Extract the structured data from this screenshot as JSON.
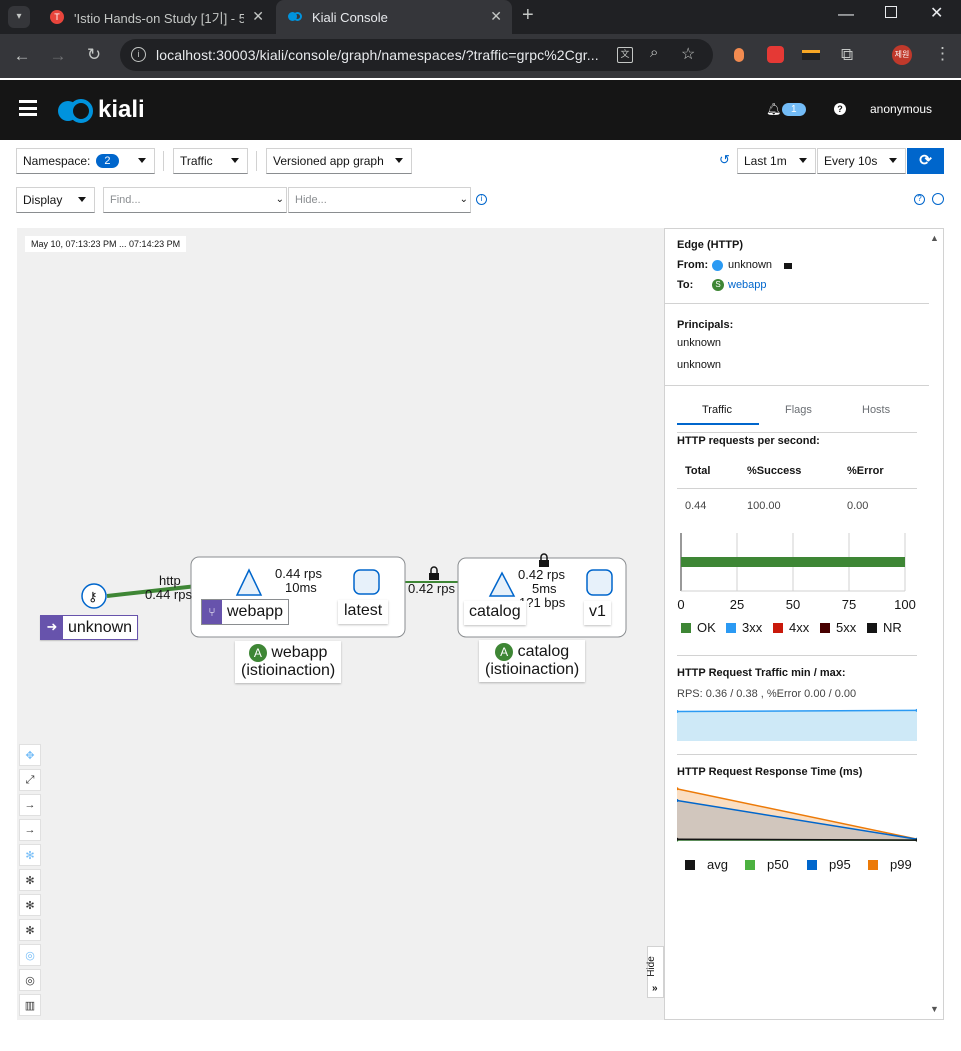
{
  "browser": {
    "tabs": [
      {
        "title": "'Istio Hands-on Study [1기] - 5",
        "active": false
      },
      {
        "title": "Kiali Console",
        "active": true
      }
    ],
    "url": "localhost:30003/kiali/console/graph/namespaces/?traffic=grpc%2Cgr...",
    "profile_label": "제원",
    "colors": {
      "tabbar": "#202124",
      "active_tab": "#35363a"
    }
  },
  "header": {
    "logo_text": "kiali",
    "notification_count": "1",
    "help_icon": "help-icon",
    "user": "anonymous"
  },
  "toolbar": {
    "namespace_label": "Namespace:",
    "namespace_count": "2",
    "traffic_label": "Traffic",
    "graph_type": "Versioned app graph",
    "duration": "Last 1m",
    "refresh_interval": "Every 10s",
    "display_label": "Display",
    "find_placeholder": "Find...",
    "hide_placeholder": "Hide..."
  },
  "graph": {
    "timestamp": "May 10, 07:13:23 PM ... 07:14:23 PM",
    "nodes": {
      "unknown": "unknown",
      "webapp_service": "webapp",
      "webapp_version": "latest",
      "catalog_service": "catalog",
      "catalog_version": "v1",
      "webapp_box_badge": "A",
      "webapp_box_name": "webapp",
      "webapp_box_ns": "(istioinaction)",
      "catalog_box_badge": "A",
      "catalog_box_name": "catalog",
      "catalog_box_ns": "(istioinaction)"
    },
    "edges": {
      "e1_protocol": "http",
      "e1_rps": "0.44 rps",
      "e2_rps": "0.44 rps",
      "e2_latency": "10ms",
      "e3_rps": "0.42 rps",
      "e4_rps": "0.42 rps",
      "e4_latency": "5ms",
      "e4_bps": "1?1 bps"
    },
    "hide_label": "Hide",
    "colors": {
      "edge": "#3e8635",
      "node_fill": "#e7f1fa",
      "node_stroke": "#0066cc",
      "app_badge": "#3e8635",
      "unknown_badge": "#6753ac"
    }
  },
  "side_panel": {
    "title": "Edge (HTTP)",
    "from_label": "From:",
    "from_value": "unknown",
    "to_label": "To:",
    "to_value": "webapp",
    "principals_label": "Principals:",
    "principal_1": "unknown",
    "principal_2": "unknown",
    "tabs": [
      "Traffic",
      "Flags",
      "Hosts"
    ],
    "rps_title": "HTTP requests per second:",
    "table": {
      "headers": [
        "Total",
        "%Success",
        "%Error"
      ],
      "row": [
        "0.44",
        "100.00",
        "0.00"
      ]
    },
    "bar_ticks": [
      "0",
      "25",
      "50",
      "75",
      "100"
    ],
    "bar_legend": [
      "OK",
      "3xx",
      "4xx",
      "5xx",
      "NR"
    ],
    "traffic_title": "HTTP Request Traffic min / max:",
    "traffic_summary": "RPS: 0.36 / 0.38 , %Error 0.00 / 0.00",
    "response_title": "HTTP Request Response Time (ms)",
    "response_legend": [
      "avg",
      "p50",
      "p95",
      "p99"
    ],
    "colors": {
      "ok": "#3e8635",
      "3xx": "#2b9af3",
      "4xx": "#c9190b",
      "5xx": "#470000",
      "nr": "#151515",
      "p50": "#4cb140",
      "p95": "#0066cc",
      "p99": "#ec7a08",
      "avg": "#151515"
    }
  },
  "chart_data": [
    {
      "type": "bar",
      "title": "HTTP requests per second:",
      "categories": [
        ""
      ],
      "series": [
        {
          "name": "OK",
          "values": [
            100
          ]
        },
        {
          "name": "3xx",
          "values": [
            0
          ]
        },
        {
          "name": "4xx",
          "values": [
            0
          ]
        },
        {
          "name": "5xx",
          "values": [
            0
          ]
        },
        {
          "name": "NR",
          "values": [
            0
          ]
        }
      ],
      "xlim": [
        0,
        100
      ],
      "grid": true,
      "legend": "bottom"
    },
    {
      "type": "area",
      "title": "HTTP Request Traffic min / max:",
      "x": [
        0,
        1
      ],
      "series": [
        {
          "name": "",
          "values": [
            0.36,
            0.38
          ]
        }
      ],
      "legend": "none"
    },
    {
      "type": "area",
      "title": "HTTP Request Response Time (ms)",
      "x": [
        0,
        1
      ],
      "series": [
        {
          "name": "p99",
          "values": [
            58,
            2
          ]
        },
        {
          "name": "p95",
          "values": [
            45,
            2
          ]
        },
        {
          "name": "p50",
          "values": [
            1,
            1
          ]
        },
        {
          "name": "avg",
          "values": [
            2,
            1
          ]
        }
      ],
      "ylim": [
        0,
        60
      ],
      "legend": "bottom"
    }
  ]
}
